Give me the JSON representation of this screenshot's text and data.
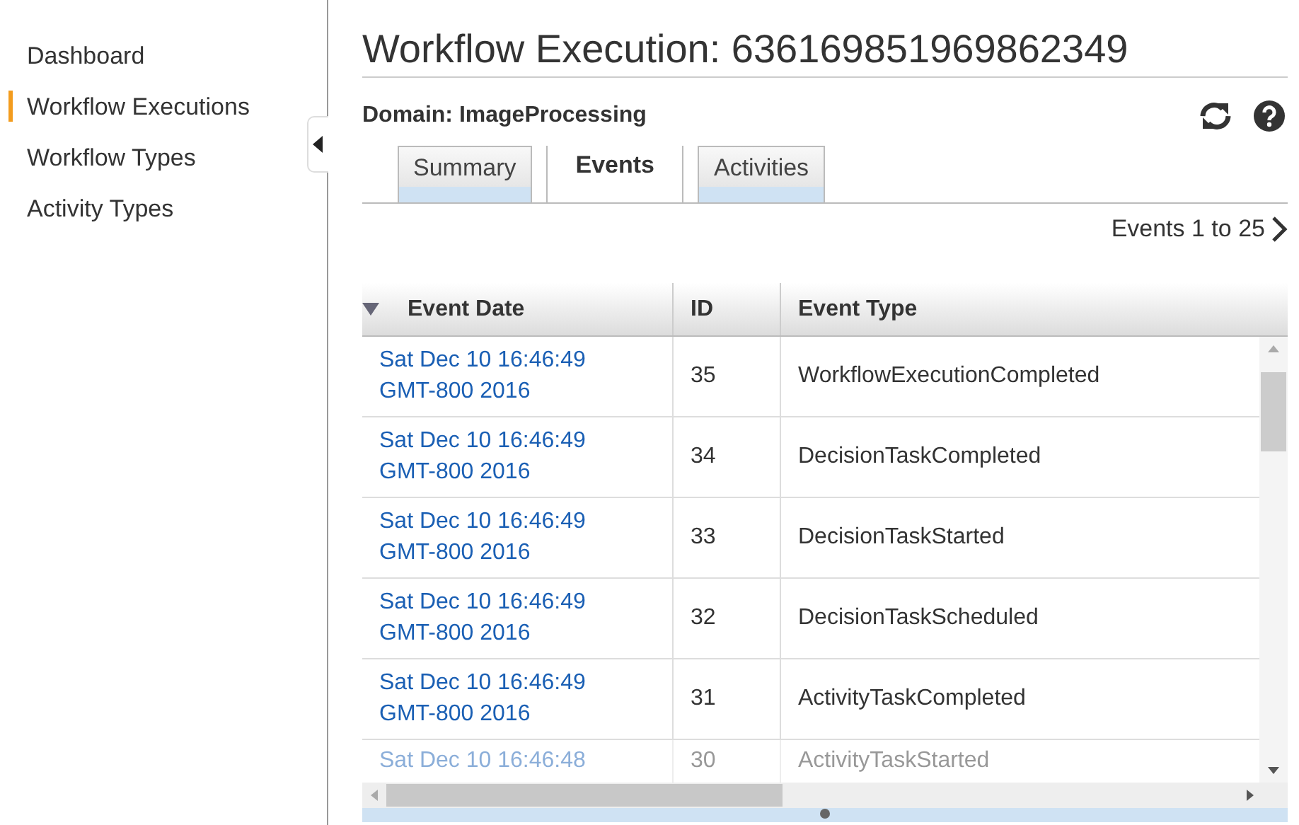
{
  "sidebar": {
    "items": [
      {
        "label": "Dashboard",
        "selected": false
      },
      {
        "label": "Workflow Executions",
        "selected": true
      },
      {
        "label": "Workflow Types",
        "selected": false
      },
      {
        "label": "Activity Types",
        "selected": false
      }
    ]
  },
  "header": {
    "title": "Workflow Execution: 636169851969862349",
    "domain": "Domain: ImageProcessing"
  },
  "tabs": [
    {
      "label": "Summary",
      "selected": false
    },
    {
      "label": "Events",
      "selected": true
    },
    {
      "label": "Activities",
      "selected": false
    }
  ],
  "pagination": {
    "label": "Events 1 to 25"
  },
  "table": {
    "columns": [
      "Event Date",
      "ID",
      "Event Type"
    ],
    "rows": [
      {
        "date_line_1": "Sat Dec 10 16:46:49",
        "date_line_2": "GMT-800 2016",
        "id": "35",
        "type": "WorkflowExecutionCompleted",
        "partial": false
      },
      {
        "date_line_1": "Sat Dec 10 16:46:49",
        "date_line_2": "GMT-800 2016",
        "id": "34",
        "type": "DecisionTaskCompleted",
        "partial": false
      },
      {
        "date_line_1": "Sat Dec 10 16:46:49",
        "date_line_2": "GMT-800 2016",
        "id": "33",
        "type": "DecisionTaskStarted",
        "partial": false
      },
      {
        "date_line_1": "Sat Dec 10 16:46:49",
        "date_line_2": "GMT-800 2016",
        "id": "32",
        "type": "DecisionTaskScheduled",
        "partial": false
      },
      {
        "date_line_1": "Sat Dec 10 16:46:49",
        "date_line_2": "GMT-800 2016",
        "id": "31",
        "type": "ActivityTaskCompleted",
        "partial": false
      },
      {
        "date_line_1": "Sat Dec 10 16:46:48",
        "id": "30",
        "type": "ActivityTaskStarted",
        "partial": true
      }
    ]
  }
}
